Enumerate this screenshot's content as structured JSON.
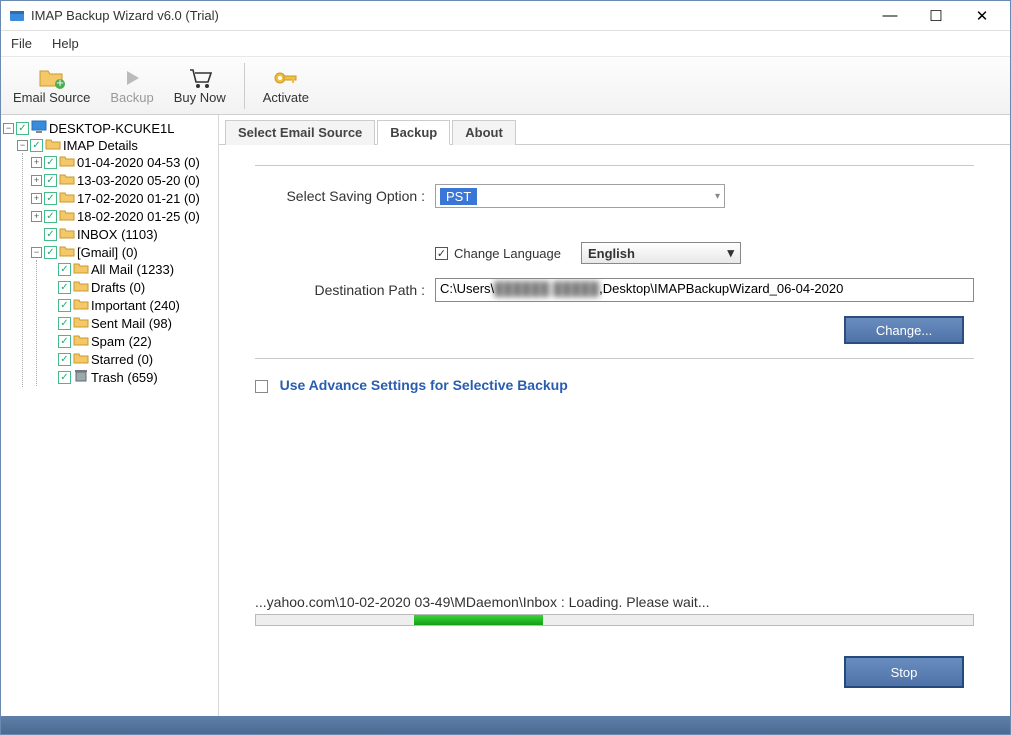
{
  "window": {
    "title": "IMAP Backup Wizard v6.0 (Trial)"
  },
  "menu": {
    "file": "File",
    "help": "Help"
  },
  "toolbar": {
    "email_source": "Email Source",
    "backup": "Backup",
    "buy_now": "Buy Now",
    "activate": "Activate"
  },
  "tree": {
    "root": "DESKTOP-KCUKE1L",
    "imap_details": "IMAP Details",
    "folders": [
      "01-04-2020 04-53 (0)",
      "13-03-2020 05-20 (0)",
      "17-02-2020 01-21 (0)",
      "18-02-2020 01-25 (0)",
      "INBOX (1103)"
    ],
    "gmail": "[Gmail] (0)",
    "gmail_sub": [
      "All Mail (1233)",
      "Drafts (0)",
      "Important (240)",
      "Sent Mail (98)",
      "Spam (22)",
      "Starred (0)",
      "Trash (659)"
    ]
  },
  "tabs": {
    "t0": "Select Email Source",
    "t1": "Backup",
    "t2": "About"
  },
  "panel": {
    "saving_label": "Select Saving Option :",
    "saving_value": "PST",
    "change_language_label": "Change Language",
    "language_value": "English",
    "dest_label": "Destination Path :",
    "dest_value_pre": "C:\\Users\\",
    "dest_value_blur": "██████ █████",
    "dest_value_post": ",Desktop\\IMAPBackupWizard_06-04-2020",
    "change_btn": "Change...",
    "advance_label": "Use Advance Settings for Selective Backup",
    "progress_text": "...yahoo.com\\10-02-2020 03-49\\MDaemon\\Inbox : Loading. Please wait...",
    "stop_btn": "Stop"
  }
}
